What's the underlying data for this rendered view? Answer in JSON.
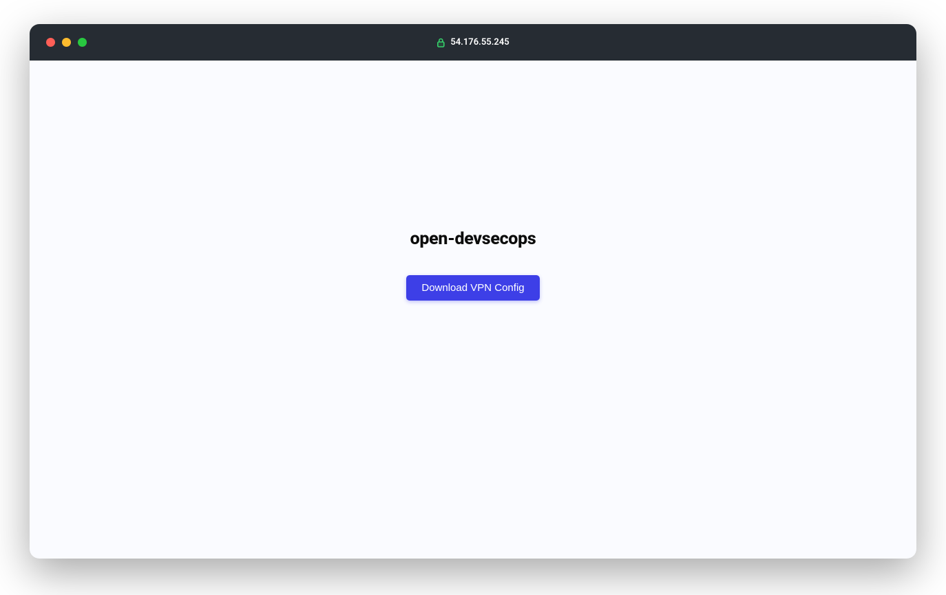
{
  "titlebar": {
    "address": "54.176.55.245"
  },
  "page": {
    "title": "open-devsecops",
    "download_button_label": "Download VPN Config"
  },
  "colors": {
    "accent": "#3d3fe7",
    "titlebar_bg": "#262c33",
    "page_bg": "#fafbff"
  }
}
